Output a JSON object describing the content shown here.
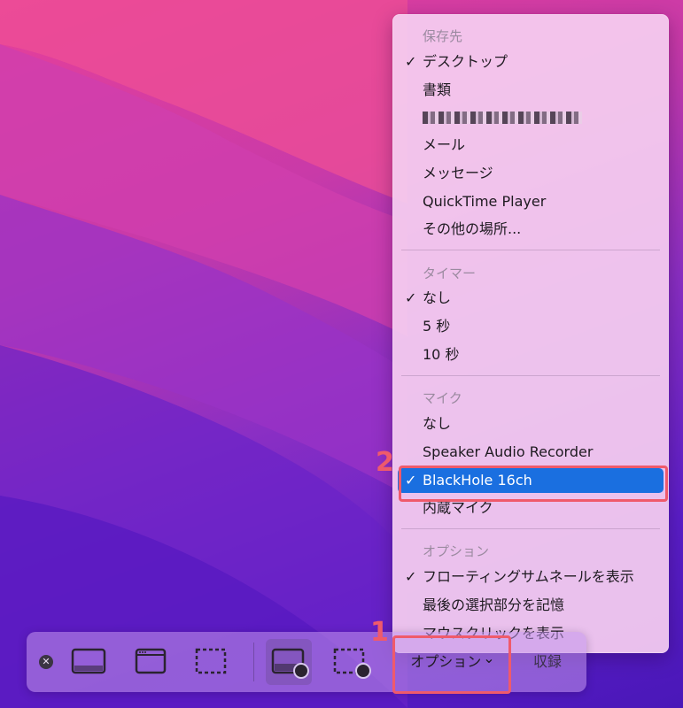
{
  "menu": {
    "save_to": {
      "header": "保存先",
      "items": [
        {
          "label": "デスクトップ",
          "checked": true
        },
        {
          "label": "書類",
          "checked": false
        },
        {
          "label": "メール",
          "checked": false
        },
        {
          "label": "メッセージ",
          "checked": false
        },
        {
          "label": "QuickTime Player",
          "checked": false
        },
        {
          "label": "その他の場所...",
          "checked": false
        }
      ]
    },
    "timer": {
      "header": "タイマー",
      "items": [
        {
          "label": "なし",
          "checked": true
        },
        {
          "label": "5 秒",
          "checked": false
        },
        {
          "label": "10 秒",
          "checked": false
        }
      ]
    },
    "mic": {
      "header": "マイク",
      "items": [
        {
          "label": "なし",
          "checked": false
        },
        {
          "label": "Speaker Audio Recorder",
          "checked": false
        },
        {
          "label": "BlackHole 16ch",
          "checked": true,
          "selected": true
        },
        {
          "label": "内蔵マイク",
          "checked": false
        }
      ]
    },
    "options": {
      "header": "オプション",
      "items": [
        {
          "label": "フローティングサムネールを表示",
          "checked": true
        },
        {
          "label": "最後の選択部分を記憶",
          "checked": false
        },
        {
          "label": "マウスクリックを表示",
          "checked": false
        }
      ]
    },
    "check_glyph": "✓"
  },
  "annotations": {
    "step1": "1",
    "step2": "2",
    "color": "#ef5a6b"
  },
  "toolbar": {
    "close_glyph": "✕",
    "options_label": "オプション",
    "options_chevron": "⌄",
    "capture_label": "収録",
    "tools": [
      {
        "icon": "capture-screen-icon"
      },
      {
        "icon": "capture-window-icon"
      },
      {
        "icon": "capture-selection-icon"
      },
      {
        "icon": "record-screen-icon",
        "active": true
      },
      {
        "icon": "record-selection-icon"
      }
    ]
  },
  "colors": {
    "selection": "#1a6fe0",
    "highlight": "#ef5a6b"
  }
}
